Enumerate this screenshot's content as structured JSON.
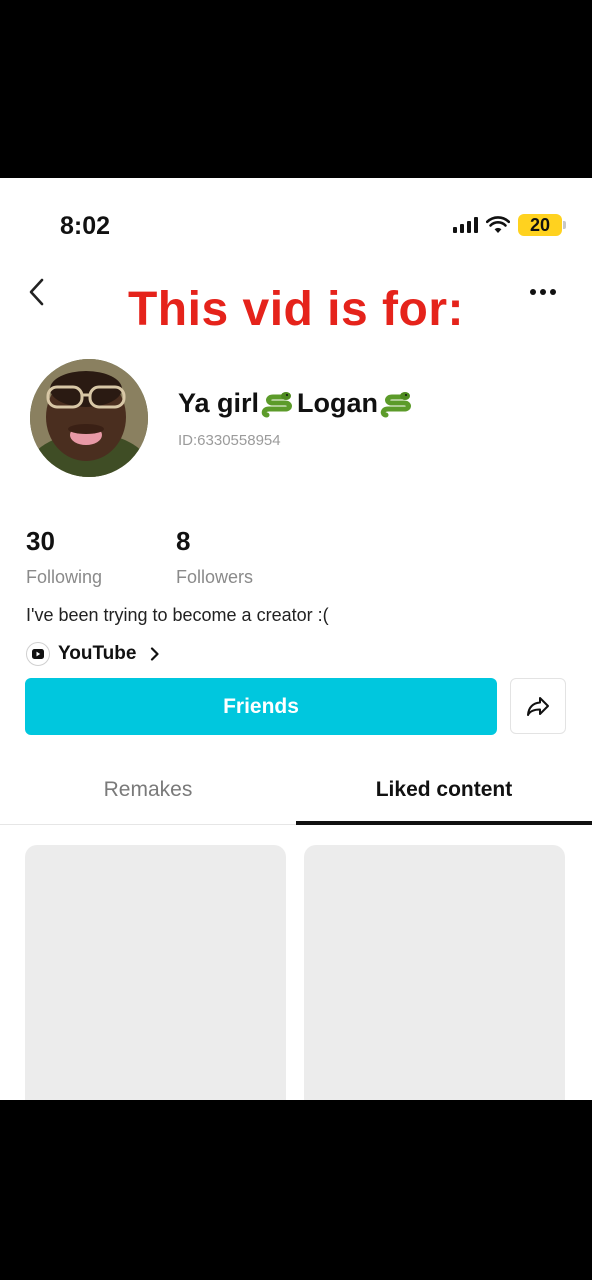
{
  "status_bar": {
    "time": "8:02",
    "battery": "20",
    "battery_color": "#ffd21f"
  },
  "nav": {
    "back_icon": "chevron-left-icon",
    "more_icon": "ellipsis-icon"
  },
  "overlay": {
    "text": "This vid is for:",
    "color": "#e5231b"
  },
  "profile": {
    "name_part1": "Ya girl ",
    "name_part2": "Logan",
    "name_emoji": "snake-emoji",
    "user_id": "ID:6330558954",
    "stats": [
      {
        "value": "30",
        "label": "Following"
      },
      {
        "value": "8",
        "label": "Followers"
      }
    ],
    "bio": "I've been trying to become a creator :(",
    "link_label": "YouTube"
  },
  "actions": {
    "friends_label": "Friends",
    "friends_color": "#00c7de",
    "share_icon": "share-arrow-icon"
  },
  "tabs": [
    {
      "label": "Remakes",
      "active": false
    },
    {
      "label": "Liked content",
      "active": true
    }
  ]
}
